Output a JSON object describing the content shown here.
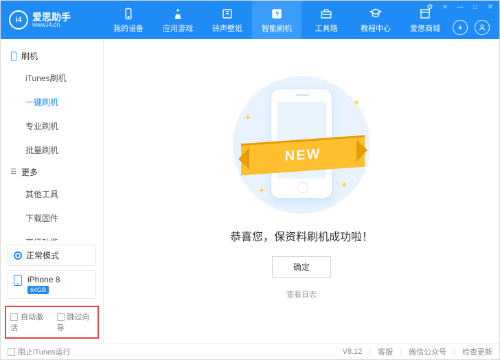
{
  "app": {
    "name": "爱思助手",
    "url": "www.i4.cn",
    "logo_text": "i4"
  },
  "tabs": [
    {
      "label": "我的设备",
      "icon": "phone-icon"
    },
    {
      "label": "应用游戏",
      "icon": "app-icon"
    },
    {
      "label": "铃声壁纸",
      "icon": "music-icon"
    },
    {
      "label": "智能刷机",
      "icon": "flash-icon",
      "active": true
    },
    {
      "label": "工具箱",
      "icon": "toolbox-icon"
    },
    {
      "label": "教程中心",
      "icon": "tutorial-icon"
    },
    {
      "label": "爱思商城",
      "icon": "store-icon"
    }
  ],
  "sidebar": {
    "groups": [
      {
        "title": "刷机",
        "icon": "phone-outline-icon",
        "items": [
          {
            "label": "iTunes刷机"
          },
          {
            "label": "一键刷机",
            "active": true
          },
          {
            "label": "专业刷机"
          },
          {
            "label": "批量刷机"
          }
        ]
      },
      {
        "title": "更多",
        "icon": "list-icon",
        "items": [
          {
            "label": "其他工具"
          },
          {
            "label": "下载固件"
          },
          {
            "label": "高级功能"
          }
        ]
      }
    ],
    "mode": {
      "label": "正常模式"
    },
    "device": {
      "name": "iPhone 8",
      "storage": "64GB"
    },
    "options": [
      {
        "label": "自动激活"
      },
      {
        "label": "跳过向导"
      }
    ]
  },
  "main": {
    "ribbon": "NEW",
    "success_text": "恭喜您，保资料刷机成功啦！",
    "ok_button": "确定",
    "view_log": "查看日志"
  },
  "footer": {
    "block_itunes": "阻止iTunes运行",
    "version": "V8.12",
    "support": "客服",
    "wechat": "微信公众号",
    "update": "检查更新"
  }
}
